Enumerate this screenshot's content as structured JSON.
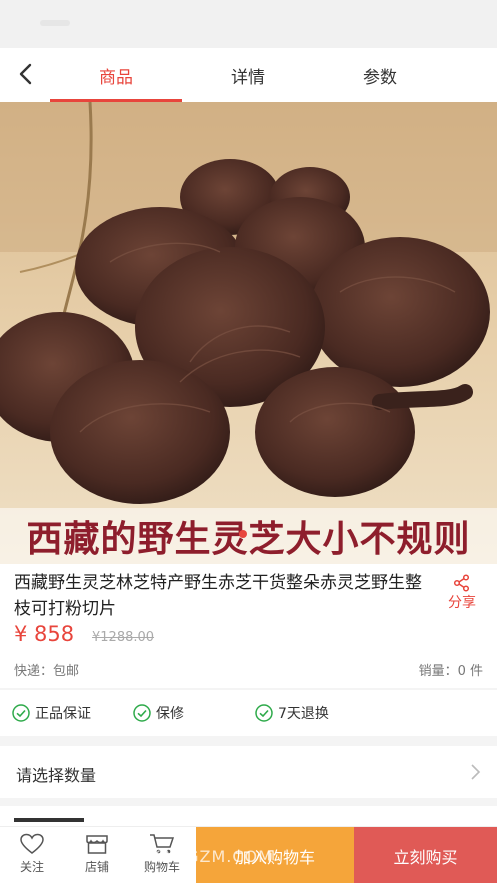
{
  "nav": {
    "tabs": [
      {
        "label": "商品",
        "active": true
      },
      {
        "label": "详情",
        "active": false
      },
      {
        "label": "参数",
        "active": false
      }
    ]
  },
  "hero": {
    "caption": "西藏的野生灵芝大小不规则"
  },
  "product": {
    "title": "西藏野生灵芝林芝特产野生赤芝干货整朵赤灵芝野生整枝可打粉切片",
    "share_label": "分享",
    "price": "¥ 858",
    "old_price": "¥1288.00",
    "shipping": "快递：包邮",
    "sales": "销量：0 件"
  },
  "guarantees": [
    {
      "label": "正品保证"
    },
    {
      "label": "保修"
    },
    {
      "label": "7天退换"
    }
  ],
  "quantity": {
    "label": "请选择数量"
  },
  "bottom_bar": {
    "follow_label": "关注",
    "shop_label": "店铺",
    "cart_label": "购物车",
    "add_to_cart": "加入购物车",
    "buy_now": "立刻购买",
    "watermark": "KANGZM.COM"
  },
  "colors": {
    "accent": "#e8453c",
    "cart_button": "#f5a53a",
    "buy_button": "#e05a56"
  }
}
